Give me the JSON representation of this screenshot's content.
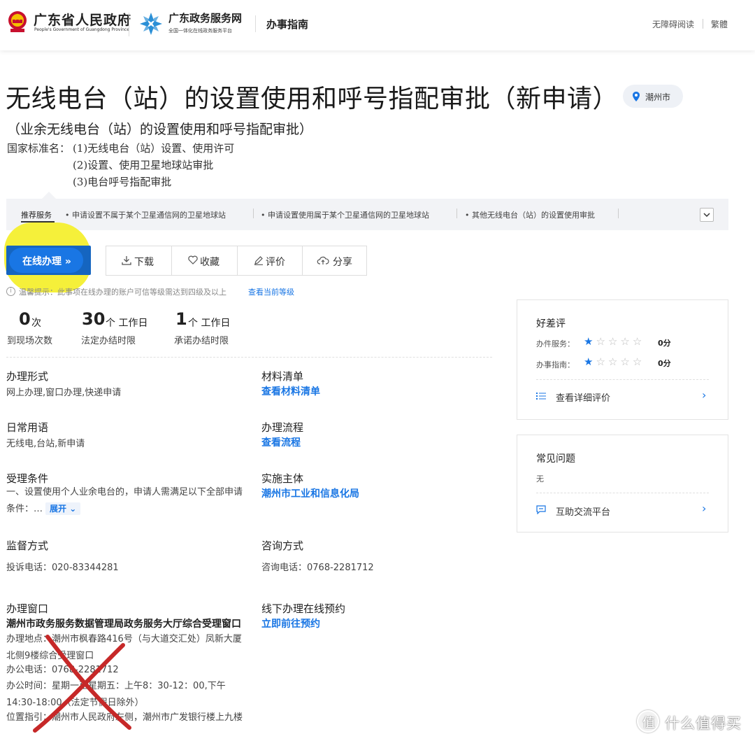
{
  "header": {
    "gov_title": "广东省人民政府",
    "gov_subtitle": "People's Government of Guangdong Province",
    "service_title": "广东政务服务网",
    "service_subtitle": "全国一体化在线政务服务平台",
    "guide_title": "办事指南",
    "accessibility": "无障碍阅读",
    "traditional": "繁體"
  },
  "title": {
    "main": "无线电台（站）的设置使用和呼号指配审批（新申请）",
    "location": "潮州市",
    "subtitle": "（业余无线电台（站）的设置使用和呼号指配审批）",
    "std_label": "国家标准名：",
    "std_items": [
      "(1)无线电台（站）设置、使用许可",
      "(2)设置、使用卫星地球站审批",
      "(3)电台呼号指配审批"
    ]
  },
  "recommended": {
    "label": "推荐服务",
    "items": [
      "申请设置不属于某个卫星通信网的卫星地球站",
      "申请设置使用属于某个卫星通信网的卫星地球站",
      "其他无线电台（站）的设置使用审批"
    ]
  },
  "actions": {
    "online": "在线办理 »",
    "download": "下载",
    "favorite": "收藏",
    "review": "评价",
    "share": "分享"
  },
  "tip": {
    "text": "温馨提示：此事项在线办理的账户可信等级需达到四级及以上",
    "link": "查看当前等级"
  },
  "stats": [
    {
      "value": "0",
      "unit": "次",
      "label": "到现场次数"
    },
    {
      "value": "30",
      "unit": "个 工作日",
      "label": "法定办结时限"
    },
    {
      "value": "1",
      "unit": "个 工作日",
      "label": "承诺办结时限"
    }
  ],
  "info": {
    "form_label": "办理形式",
    "form_value": "网上办理,窗口办理,快递申请",
    "materials_label": "材料清单",
    "materials_link": "查看材料清单",
    "terms_label": "日常用语",
    "terms_value": "无线电,台站,新申请",
    "process_label": "办理流程",
    "process_link": "查看流程",
    "conditions_label": "受理条件",
    "conditions_value": "一、设置使用个人业余电台的，申请人需满足以下全部申请条件：…",
    "expand": "展开",
    "subject_label": "实施主体",
    "subject_link": "潮州市工业和信息化局",
    "supervision_label": "监督方式",
    "supervision_value": "投诉电话：020-83344281",
    "consult_label": "咨询方式",
    "consult_value": "咨询电话：0768-2281712",
    "window_label": "办理窗口",
    "window_name": "潮州市政务服务数据管理局政务服务大厅综合受理窗口",
    "window_address": "办理地点：潮州市枫春路416号（与大道交汇处）凤新大厦北侧9楼综合受理窗口",
    "window_phone": "办公电话：0768-2281712",
    "window_hours": "办公时间：星期一至星期五：上午8：30-12：00,下午14:30-18:00（法定节假日除外）",
    "window_guide": "位置指引：潮州市人民政府左侧，潮州市广发银行楼上九楼",
    "booking_label": "线下办理在线预约",
    "booking_link": "立即前往预约"
  },
  "rating_panel": {
    "title": "好差评",
    "service_label": "办件服务：",
    "service_rating": 1,
    "service_score": "0分",
    "guide_label": "办事指南：",
    "guide_rating": 1,
    "guide_score": "0分",
    "detail_link": "查看详细评价"
  },
  "faq_panel": {
    "title": "常见问题",
    "value": "无",
    "link": "互助交流平台"
  },
  "watermark": {
    "badge": "值",
    "text": "什么值得买"
  },
  "colors": {
    "primary": "#1976e4",
    "highlight": "#f5f03a",
    "annotation_x": "#c62828"
  }
}
